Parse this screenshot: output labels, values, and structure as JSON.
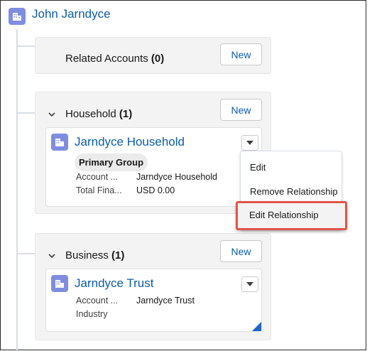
{
  "header": {
    "title": "John Jarndyce",
    "icon": "account-icon"
  },
  "cards": [
    {
      "title": "Related Accounts",
      "count": "(0)",
      "new_label": "New"
    },
    {
      "title": "Household",
      "count": "(1)",
      "new_label": "New"
    },
    {
      "title": "Business",
      "count": "(1)",
      "new_label": "New"
    }
  ],
  "household_tile": {
    "name": "Jarndyce Household",
    "badge": "Primary Group",
    "fields": [
      {
        "label": "Account ...",
        "value": "Jarndyce Household"
      },
      {
        "label": "Total Fina...",
        "value": "USD 0.00"
      }
    ]
  },
  "business_tile": {
    "name": "Jarndyce Trust",
    "fields": [
      {
        "label": "Account ...",
        "value": "Jarndyce Trust"
      },
      {
        "label": "Industry",
        "value": ""
      }
    ]
  },
  "dropdown_menu": {
    "items": [
      "Edit",
      "Remove Relationship",
      "Edit Relationship"
    ],
    "highlighted_item": "Edit Relationship",
    "highlight_color": "#e0554a"
  },
  "colors": {
    "link": "#0b5cab",
    "account_icon": "#7f8de1",
    "card_bg": "#f3f3f3"
  }
}
